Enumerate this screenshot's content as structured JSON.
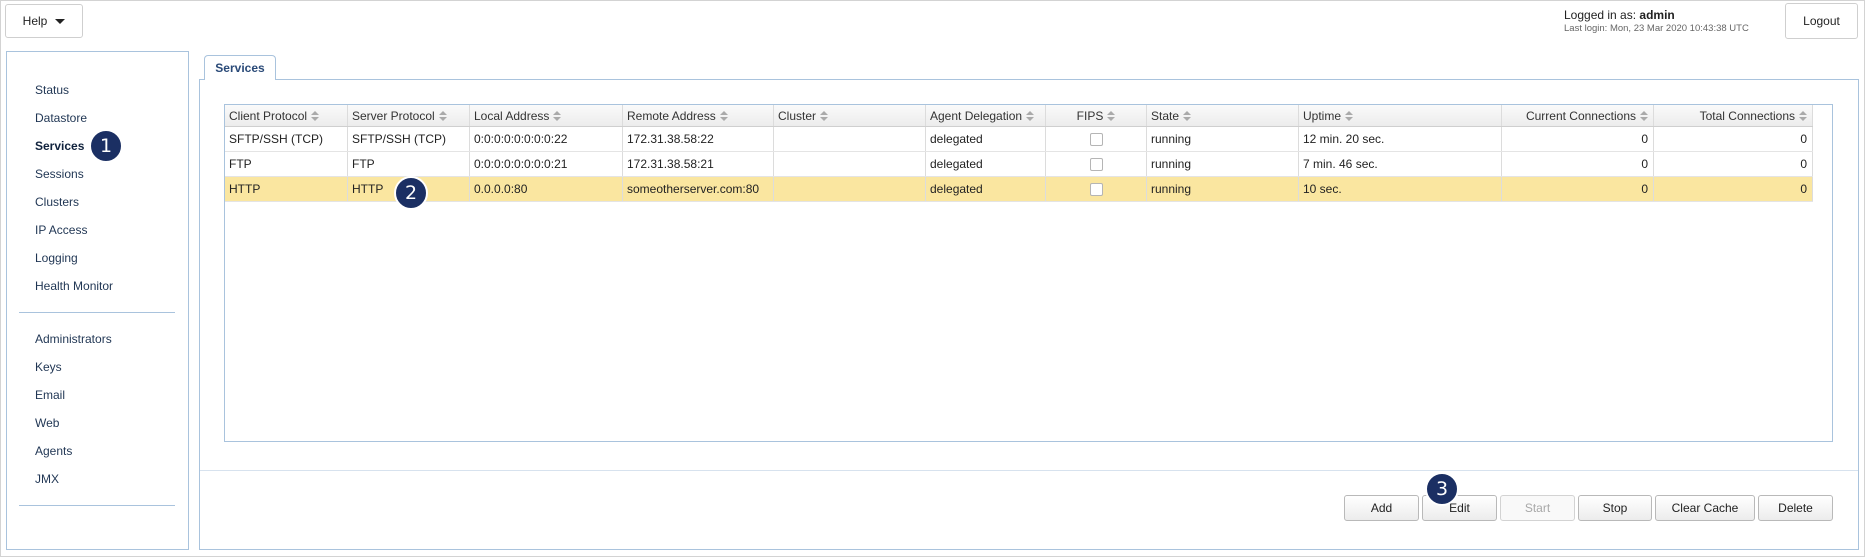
{
  "header": {
    "help_label": "Help",
    "logged_in_prefix": "Logged in as:",
    "logged_in_user": "admin",
    "last_login": "Last login: Mon, 23 Mar 2020 10:43:38 UTC",
    "logout_label": "Logout"
  },
  "sidebar": {
    "group1": [
      "Status",
      "Datastore",
      "Services",
      "Sessions",
      "Clusters",
      "IP Access",
      "Logging",
      "Health Monitor"
    ],
    "group2": [
      "Administrators",
      "Keys",
      "Email",
      "Web",
      "Agents",
      "JMX"
    ],
    "active": "Services"
  },
  "tab": {
    "label": "Services"
  },
  "table": {
    "columns": [
      "Client Protocol",
      "Server Protocol",
      "Local Address",
      "Remote Address",
      "Cluster",
      "Agent Delegation",
      "FIPS",
      "State",
      "Uptime",
      "Current Connections",
      "Total Connections"
    ],
    "rows": [
      {
        "client": "SFTP/SSH (TCP)",
        "server": "SFTP/SSH (TCP)",
        "local": "0:0:0:0:0:0:0:0:22",
        "remote": "172.31.38.58:22",
        "cluster": "",
        "delegation": "delegated",
        "fips": false,
        "state": "running",
        "uptime": "12 min. 20 sec.",
        "current": "0",
        "total": "0",
        "selected": false
      },
      {
        "client": "FTP",
        "server": "FTP",
        "local": "0:0:0:0:0:0:0:0:21",
        "remote": "172.31.38.58:21",
        "cluster": "",
        "delegation": "delegated",
        "fips": false,
        "state": "running",
        "uptime": "7 min. 46 sec.",
        "current": "0",
        "total": "0",
        "selected": false
      },
      {
        "client": "HTTP",
        "server": "HTTP",
        "local": "0.0.0.0:80",
        "remote": "someotherserver.com:80",
        "cluster": "",
        "delegation": "delegated",
        "fips": false,
        "state": "running",
        "uptime": "10 sec.",
        "current": "0",
        "total": "0",
        "selected": true
      }
    ]
  },
  "buttons": {
    "add": "Add",
    "edit": "Edit",
    "start": "Start",
    "stop": "Stop",
    "clear_cache": "Clear Cache",
    "delete": "Delete"
  },
  "callouts": [
    "1",
    "2",
    "3"
  ]
}
